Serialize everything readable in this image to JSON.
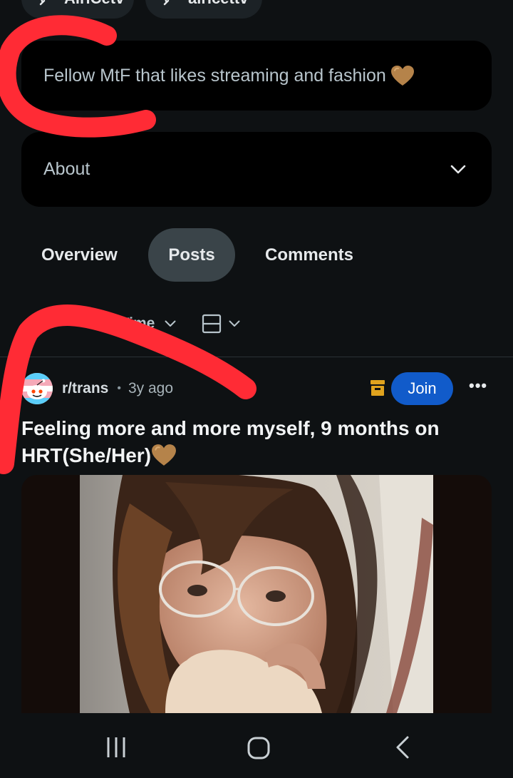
{
  "profile": {
    "chips": [
      {
        "label": "AiriCetv"
      },
      {
        "label": "airicettv"
      }
    ],
    "bio": "Fellow MtF that likes streaming and fashion",
    "about_label": "About"
  },
  "tabs": [
    {
      "label": "Overview"
    },
    {
      "label": "Posts",
      "selected": true
    },
    {
      "label": "Comments"
    }
  ],
  "filters": {
    "sort_label": "All Time",
    "layout_icon": "card-layout-icon"
  },
  "post": {
    "subreddit": "r/trans",
    "separator": "•",
    "age": "3y ago",
    "join_label": "Join",
    "more_label": "•••",
    "title": "Feeling more and more myself, 9 months on HRT(She/Her)",
    "emoji_icon": "brown-heart-icon"
  },
  "colors": {
    "background": "#0e1113",
    "join": "#115bca",
    "selected_tab": "#3a4449",
    "annotation": "#ff2b35",
    "heart": "#b5834a"
  }
}
